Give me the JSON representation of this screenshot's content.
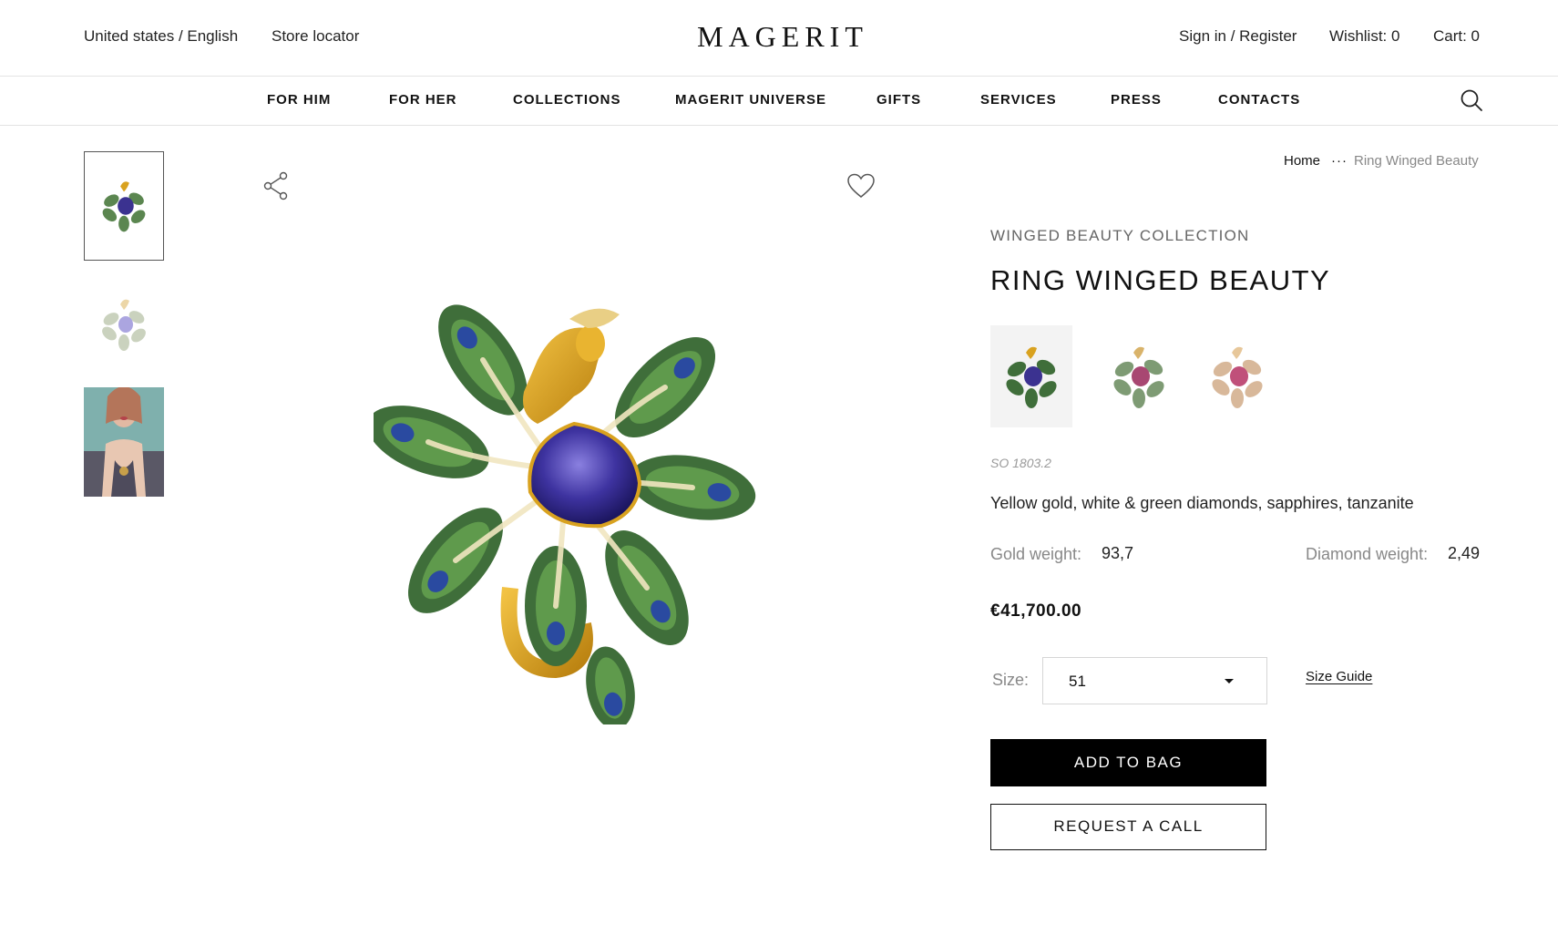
{
  "header": {
    "locale": "United states / English",
    "store_locator": "Store locator",
    "logo": "MAGERIT",
    "sign_in": "Sign in / Register",
    "wishlist": "Wishlist: 0",
    "cart": "Cart: 0"
  },
  "nav": {
    "items": [
      "FOR HIM",
      "FOR HER",
      "COLLECTIONS",
      "MAGERIT UNIVERSE",
      "GIFTS",
      "SERVICES",
      "PRESS",
      "CONTACTS"
    ],
    "search_icon": "search-icon"
  },
  "breadcrumb": {
    "home": "Home",
    "separator": "···",
    "current": "Ring Winged Beauty"
  },
  "product": {
    "collection": "WINGED BEAUTY COLLECTION",
    "title": "RING WINGED BEAUTY",
    "sku": "SO 1803.2",
    "material": "Yellow gold, white & green diamonds, sapphires, tanzanite",
    "gold_weight_label": "Gold weight:",
    "gold_weight": "93,7",
    "diamond_weight_label": "Diamond weight:",
    "diamond_weight": "2,49",
    "price": "€41,700.00",
    "size_label": "Size:",
    "size_value": "51",
    "size_guide": "Size Guide",
    "add_to_bag": "ADD TO BAG",
    "request_call": "REQUEST A CALL"
  },
  "colors": {
    "gold": "#d9a21f",
    "tanzanite": "#4a3fa3",
    "green_stone": "#3f6e3a",
    "sapphire": "#2a4aa0",
    "pink_stone": "#c0507a"
  }
}
